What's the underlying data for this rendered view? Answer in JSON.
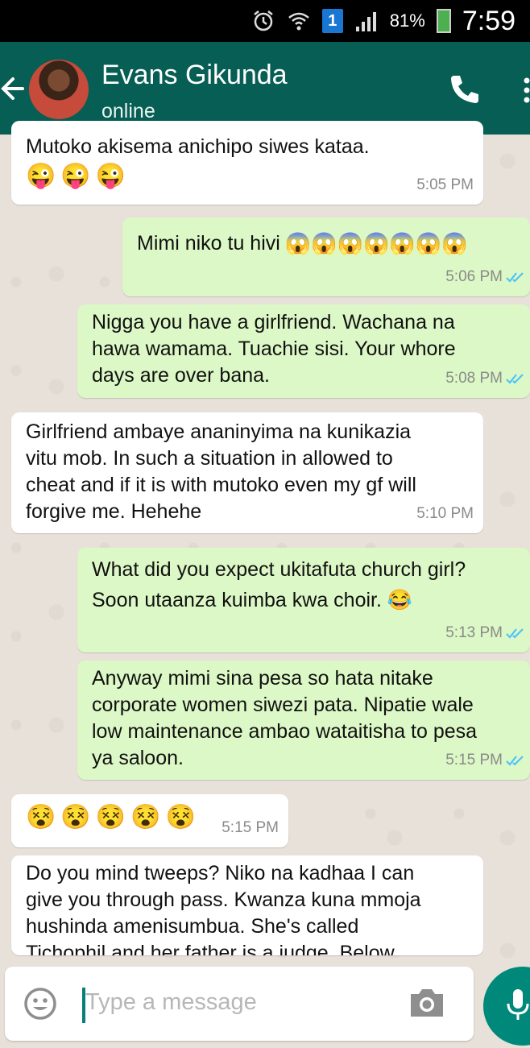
{
  "status_bar": {
    "battery": "81%",
    "sim": "1",
    "time": "7:59"
  },
  "header": {
    "contact_name": "Evans Gikunda",
    "contact_status": "online"
  },
  "messages": [
    {
      "direction": "in",
      "text": "Mutoko akisema anichipo siwes kataa.",
      "emojis": [
        "😜",
        "😜",
        "😜"
      ],
      "time": "5:05 PM"
    },
    {
      "direction": "out",
      "text": "Mimi niko tu hivi",
      "emojis": [
        "😱",
        "😱",
        "😱",
        "😱",
        "😱",
        "😱",
        "😱"
      ],
      "time": "5:06 PM"
    },
    {
      "direction": "out",
      "text": "Nigga you have a girlfriend. Wachana na\nhawa wamama. Tuachie sisi. Your whore\ndays are over bana.",
      "time": "5:08 PM"
    },
    {
      "direction": "in",
      "text": "Girlfriend ambaye ananinyima na kunikazia\nvitu mob. In such a situation in allowed to\ncheat and if it is with mutoko even my gf will\nforgive me. Hehehe",
      "time": "5:10 PM"
    },
    {
      "direction": "out",
      "text": "What did you expect ukitafuta church girl?\nSoon utaanza kuimba kwa choir. 😂",
      "time": "5:13 PM"
    },
    {
      "direction": "out",
      "text": "Anyway mimi sina pesa so hata nitake\ncorporate women siwezi pata. Nipatie wale\nlow maintenance ambao wataitisha to pesa\nya saloon.",
      "time": "5:15 PM"
    },
    {
      "direction": "in",
      "emojis": [
        "😵",
        "😵",
        "😵",
        "😵",
        "😵"
      ],
      "time": "5:15 PM"
    },
    {
      "direction": "in",
      "text": "Do you mind tweeps? Niko na kadhaa I can\ngive you through pass. Kwanza kuna mmoja\nhushinda amenisumbua. She's called\nTichophil and her father is a judge. Below"
    }
  ],
  "input": {
    "placeholder": "Type a message"
  },
  "colors": {
    "header": "#075e54",
    "outgoing_bubble": "#dcf8c6",
    "incoming_bubble": "#ffffff",
    "read_ticks": "#4fc3f7",
    "mic_button": "#00897b"
  },
  "icons": [
    "alarm-icon",
    "wifi-icon",
    "signal-icon",
    "battery-icon",
    "back-arrow-icon",
    "phone-icon",
    "emoji-icon",
    "camera-icon",
    "mic-icon",
    "read-ticks-icon"
  ]
}
